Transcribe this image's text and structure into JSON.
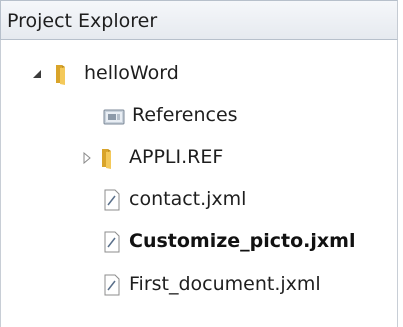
{
  "panel": {
    "title": "Project Explorer"
  },
  "tree": {
    "items": [
      {
        "label": "helloWord",
        "icon": "folder-open-icon",
        "expander": "expanded"
      },
      {
        "label": "References",
        "icon": "references-icon"
      },
      {
        "label": "APPLI.REF",
        "icon": "folder-icon",
        "expander": "collapsed"
      },
      {
        "label": "contact.jxml",
        "icon": "file-icon"
      },
      {
        "label": "Customize_picto.jxml",
        "icon": "file-icon",
        "bold": true
      },
      {
        "label": "First_document.jxml",
        "icon": "file-icon"
      }
    ]
  },
  "colors": {
    "folder": "#e8b53a",
    "header_bg": "#e9edf2",
    "text": "#1e1e1e"
  }
}
